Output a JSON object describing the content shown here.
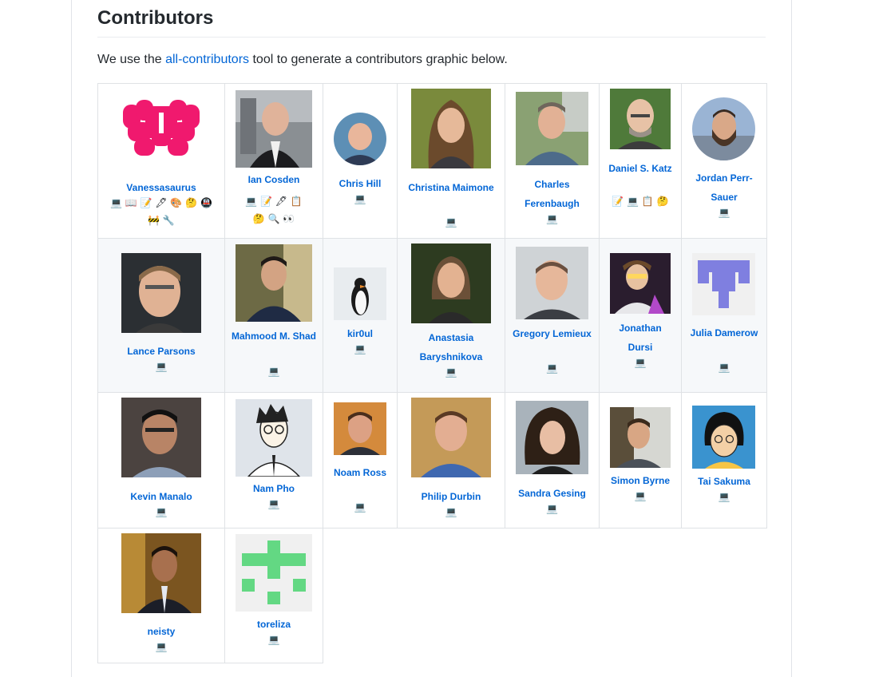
{
  "heading": "Contributors",
  "intro": {
    "before": "We use the ",
    "link": "all-contributors",
    "after": " tool to generate a contributors graphic below."
  },
  "contributors": [
    {
      "name": "Vanessasaurus",
      "types": "💻 📖 📝 🖋 🎨 🤔 🚇 🚧 🔧"
    },
    {
      "name": "Ian Cosden",
      "types": "💻 📝 🖋 📋 🤔 🔍 👀"
    },
    {
      "name": "Chris Hill",
      "types": "💻"
    },
    {
      "name": "Christina Maimone",
      "types": "💻"
    },
    {
      "name": "Charles Ferenbaugh",
      "types": "💻"
    },
    {
      "name": "Daniel S. Katz",
      "types": "📝 💻 📋 🤔"
    },
    {
      "name": "Jordan Perr-Sauer",
      "types": "💻"
    },
    {
      "name": "Lance Parsons",
      "types": "💻"
    },
    {
      "name": "Mahmood M. Shad",
      "types": "💻"
    },
    {
      "name": "kir0ul",
      "types": "💻"
    },
    {
      "name": "Anastasia Baryshnikova",
      "types": "💻"
    },
    {
      "name": "Gregory Lemieux",
      "types": "💻"
    },
    {
      "name": "Jonathan Dursi",
      "types": "💻"
    },
    {
      "name": "Julia Damerow",
      "types": "💻"
    },
    {
      "name": "Kevin Manalo",
      "types": "💻"
    },
    {
      "name": "Nam Pho",
      "types": "💻"
    },
    {
      "name": "Noam Ross",
      "types": "💻"
    },
    {
      "name": "Philip Durbin",
      "types": "💻"
    },
    {
      "name": "Sandra Gesing",
      "types": "💻"
    },
    {
      "name": "Simon Byrne",
      "types": "💻"
    },
    {
      "name": "Tai Sakuma",
      "types": "💻"
    },
    {
      "name": "neisty",
      "types": "💻"
    },
    {
      "name": "toreliza",
      "types": "💻"
    }
  ],
  "colors": {
    "link": "#0366d6",
    "identicon_pink": "#f0196e",
    "identicon_purple": "#7f7fe0",
    "identicon_green": "#63d883"
  }
}
